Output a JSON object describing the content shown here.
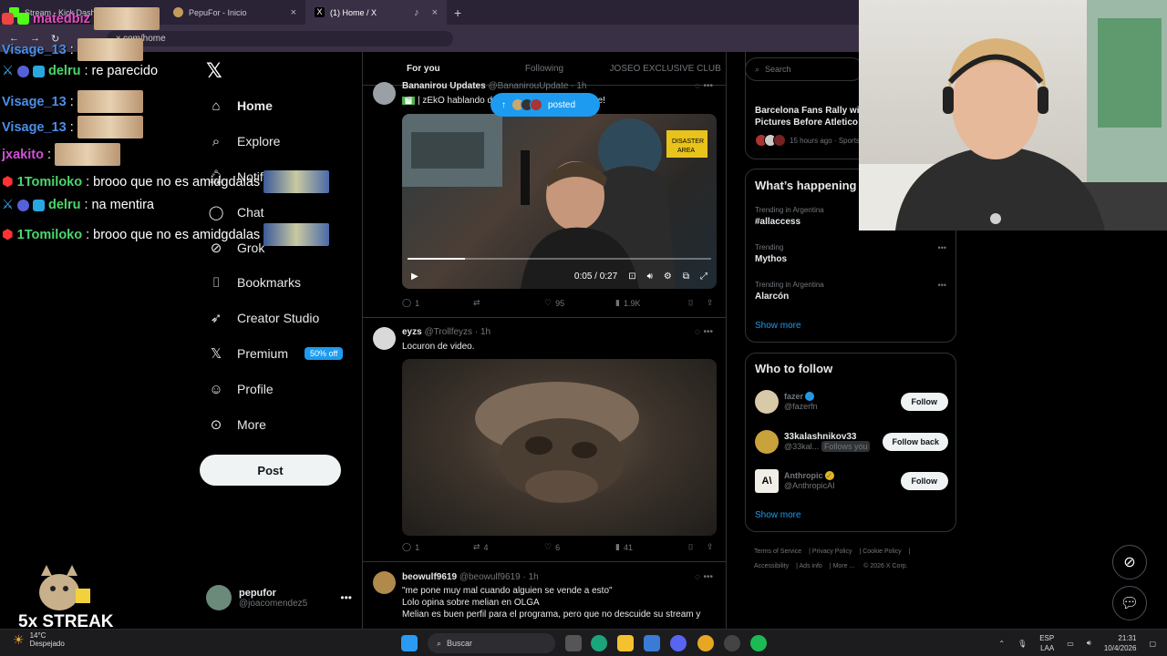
{
  "browser": {
    "tabs": [
      {
        "label": "Stream - Kick Dashb",
        "active": false
      },
      {
        "label": "PepuFor - Inicio",
        "active": false
      },
      {
        "label": "(1) Home / X",
        "active": true
      }
    ],
    "address": "x.com/home"
  },
  "nav": {
    "items": [
      {
        "label": "Home",
        "icon": "home-icon"
      },
      {
        "label": "Explore",
        "icon": "search-icon"
      },
      {
        "label": "Notifications",
        "icon": "bell-icon"
      },
      {
        "label": "Chat",
        "icon": "chat-icon"
      },
      {
        "label": "Grok",
        "icon": "grok-icon"
      },
      {
        "label": "Bookmarks",
        "icon": "bookmark-icon"
      },
      {
        "label": "Creator Studio",
        "icon": "rocket-icon"
      },
      {
        "label": "Premium",
        "icon": "x-icon"
      },
      {
        "label": "Profile",
        "icon": "person-icon"
      },
      {
        "label": "More",
        "icon": "more-circle-icon"
      }
    ],
    "premium_badge": "50% off",
    "post_label": "Post",
    "account": {
      "name": "pepufor",
      "handle": "@joacomendez5"
    }
  },
  "feed": {
    "tabs": [
      "For you",
      "Following",
      "JOSEO EXCLUSIVE CLUB"
    ],
    "posted_pill": "posted",
    "tweets": [
      {
        "name": "Bananirou Updates",
        "handle": "@BananirouUpdate",
        "time": "1h",
        "text": "| zEkO hablando d",
        "text_end": "e!",
        "video_time": "0:05 / 0:27",
        "replies": "1",
        "reposts": "",
        "likes": "95",
        "views": "1.9K"
      },
      {
        "name": "eyzs",
        "handle": "@Trollfeyzs",
        "time": "1h",
        "text": "Locuron de video.",
        "replies": "1",
        "reposts": "4",
        "likes": "6",
        "views": "41"
      },
      {
        "name": "beowulf9619",
        "handle": "@beowulf9619",
        "time": "1h",
        "lines": [
          "\"me pone muy mal cuando alguien se vende a esto\"",
          "Lolo opina sobre melian en OLGA",
          "Melian es buen perfil para el programa, pero que no descuide su stream y"
        ]
      }
    ]
  },
  "right": {
    "search_placeholder": "Search",
    "news": {
      "title": "Barcelona Fans Rally with Pictures Before Atletico",
      "meta": "15 hours ago · Sports"
    },
    "happening_title": "What’s happening",
    "trends": [
      {
        "category": "Trending in Argentina",
        "name": "#allaccess"
      },
      {
        "category": "Trending",
        "name": "Mythos"
      },
      {
        "category": "Trending in Argentina",
        "name": "Alarcón"
      }
    ],
    "show_more": "Show more",
    "wtf_title": "Who to follow",
    "follows": [
      {
        "name": "fazer",
        "handle": "@fazerfn",
        "button": "Follow",
        "verified": "blue"
      },
      {
        "name": "33kalashnikov33",
        "handle": "@33kal...",
        "button": "Follow back",
        "follows_you": "Follows you"
      },
      {
        "name": "Anthropic",
        "handle": "@AnthropicAI",
        "button": "Follow",
        "verified": "gold"
      }
    ],
    "footer": [
      "Terms of Service",
      "Privacy Policy",
      "Cookie Policy",
      "Accessibility",
      "Ads info",
      "More ...",
      "© 2026 X Corp."
    ]
  },
  "chat": [
    {
      "user": "Visage_13",
      "color": "#4a8fe8",
      "msg": ""
    },
    {
      "user": "delru",
      "color": "#4ad66d",
      "msg": "re parecido",
      "badges": true
    },
    {
      "user": "Visage_13",
      "color": "#4a8fe8",
      "msg": ""
    },
    {
      "user": "Visage_13",
      "color": "#4a8fe8",
      "msg": ""
    },
    {
      "user": "jxakito",
      "color": "#d24fd8",
      "msg": ""
    },
    {
      "user": "1Tomiloko",
      "color": "#4ad66d",
      "msg": "brooo que no es amidgdalas",
      "badges": true
    },
    {
      "user": "delru",
      "color": "#4ad66d",
      "msg": "na mentira",
      "badges": true
    },
    {
      "user": "1Tomiloko",
      "color": "#4ad66d",
      "msg": "brooo que no es amidgdalas",
      "badges": true
    }
  ],
  "chat_header_user": "matedbiz",
  "streak": "5x STREAK",
  "taskbar": {
    "temp": "14°C",
    "weather": "Despejado",
    "search": "Buscar",
    "lang": "ESP",
    "lang2": "LAA",
    "time": "21:31",
    "date": "10/4/2026"
  }
}
